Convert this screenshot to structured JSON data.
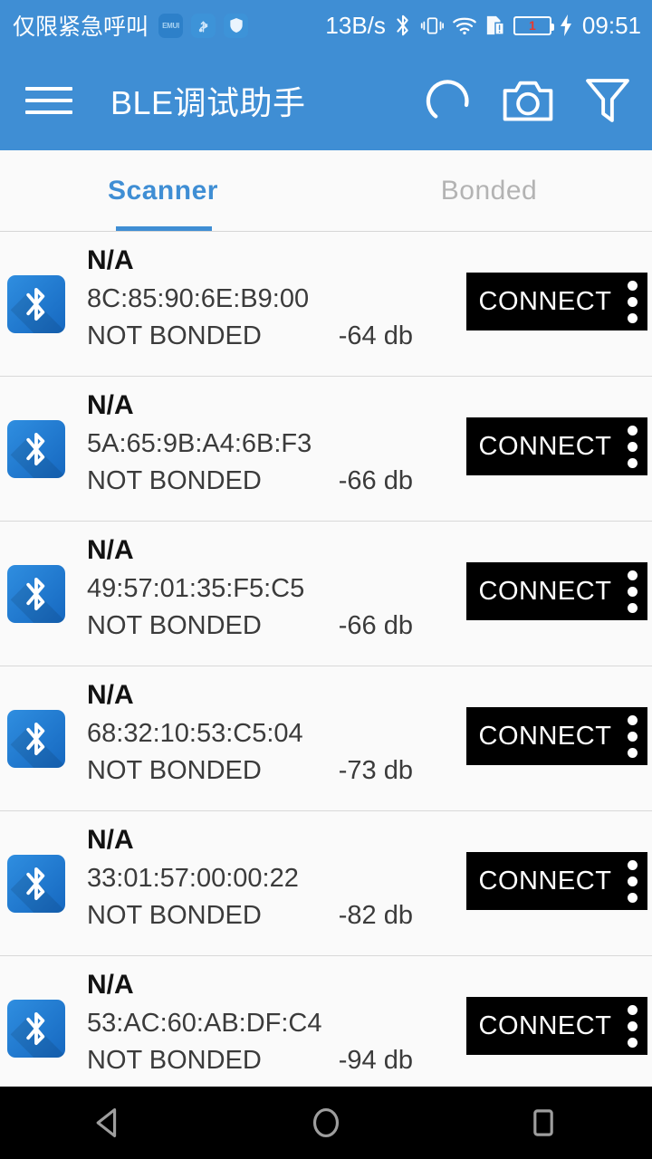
{
  "status_bar": {
    "carrier": "仅限紧急呼叫",
    "badges": [
      {
        "name": "emui-badge",
        "text": "EMUI"
      },
      {
        "name": "usb-icon",
        "text": ""
      },
      {
        "name": "shield-icon",
        "text": ""
      }
    ],
    "network_speed": "13B/s",
    "icons": [
      "bluetooth-icon",
      "vibrate-icon",
      "wifi-icon",
      "sim-alert-icon",
      "battery-icon",
      "charging-bolt-icon"
    ],
    "battery_level": "1",
    "time": "09:51"
  },
  "toolbar": {
    "menu_icon": "hamburger-menu-icon",
    "title": "BLE调试助手",
    "actions": [
      {
        "name": "scanning-spinner-icon",
        "label": "Scanning"
      },
      {
        "name": "camera-icon",
        "label": "Camera"
      },
      {
        "name": "filter-icon",
        "label": "Filter"
      }
    ]
  },
  "tabs": [
    {
      "label": "Scanner",
      "active": true
    },
    {
      "label": "Bonded",
      "active": false
    }
  ],
  "devices": [
    {
      "name": "N/A",
      "mac": "8C:85:90:6E:B9:00",
      "bond_state": "NOT BONDED",
      "rssi": "-64 db",
      "action": "CONNECT"
    },
    {
      "name": "N/A",
      "mac": "5A:65:9B:A4:6B:F3",
      "bond_state": "NOT BONDED",
      "rssi": "-66 db",
      "action": "CONNECT"
    },
    {
      "name": "N/A",
      "mac": "49:57:01:35:F5:C5",
      "bond_state": "NOT BONDED",
      "rssi": "-66 db",
      "action": "CONNECT"
    },
    {
      "name": "N/A",
      "mac": "68:32:10:53:C5:04",
      "bond_state": "NOT BONDED",
      "rssi": "-73 db",
      "action": "CONNECT"
    },
    {
      "name": "N/A",
      "mac": "33:01:57:00:00:22",
      "bond_state": "NOT BONDED",
      "rssi": "-82 db",
      "action": "CONNECT"
    },
    {
      "name": "N/A",
      "mac": "53:AC:60:AB:DF:C4",
      "bond_state": "NOT BONDED",
      "rssi": "-94 db",
      "action": "CONNECT"
    }
  ],
  "nav_bar": [
    {
      "name": "back-button"
    },
    {
      "name": "home-button"
    },
    {
      "name": "recents-button"
    }
  ],
  "colors": {
    "primary": "#3f8ed4",
    "accent": "#3f8ed4",
    "background": "#fafafa",
    "button": "#000000",
    "battery_warning": "#e8392e",
    "tab_inactive": "#b3b3b3"
  }
}
